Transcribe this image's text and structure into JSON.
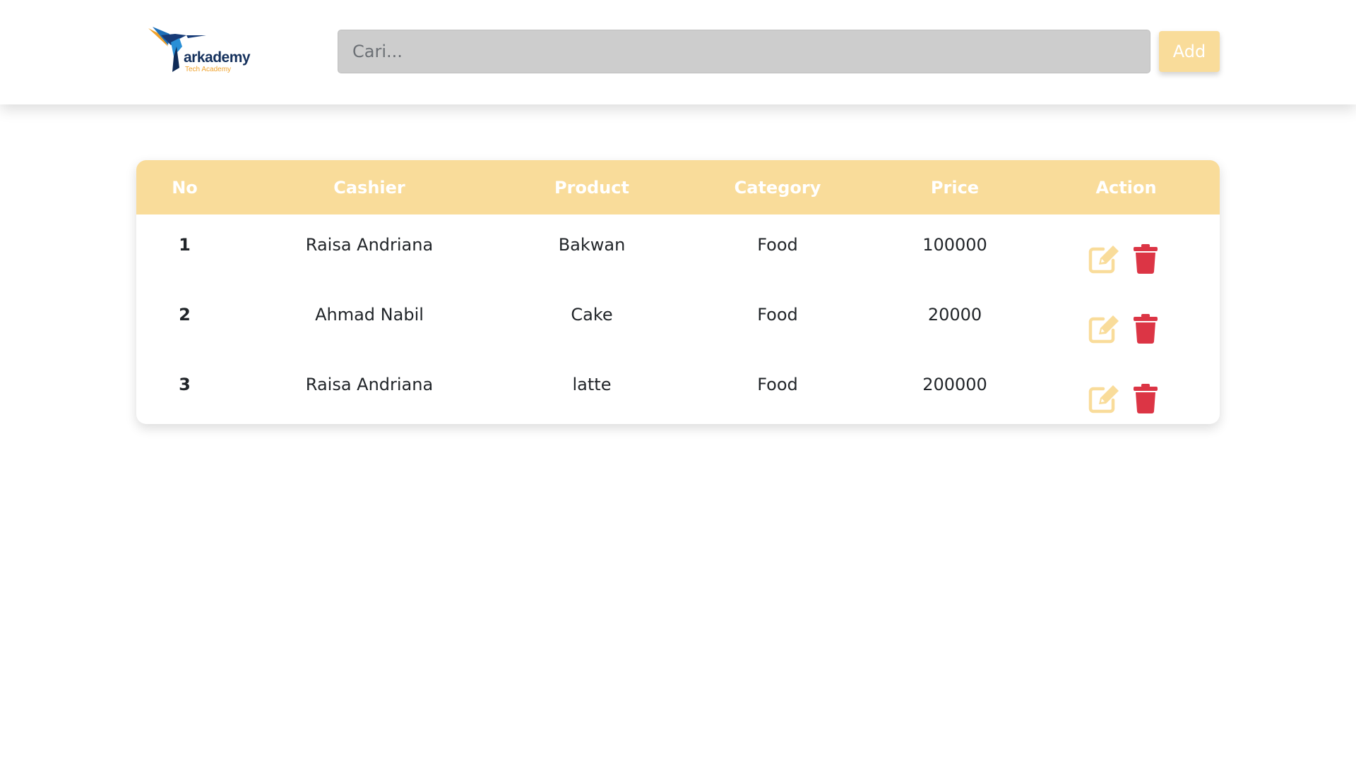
{
  "header": {
    "logo": {
      "name": "arkademy",
      "tagline": "Tech Academy"
    },
    "search": {
      "placeholder": "Cari...",
      "value": ""
    },
    "add_label": "Add"
  },
  "table": {
    "columns": [
      "No",
      "Cashier",
      "Product",
      "Category",
      "Price",
      "Action"
    ],
    "rows": [
      {
        "no": "1",
        "cashier": "Raisa Andriana",
        "product": "Bakwan",
        "category": "Food",
        "price": "100000"
      },
      {
        "no": "2",
        "cashier": "Ahmad Nabil",
        "product": "Cake",
        "category": "Food",
        "price": "20000"
      },
      {
        "no": "3",
        "cashier": "Raisa Andriana",
        "product": "latte",
        "category": "Food",
        "price": "200000"
      }
    ],
    "action_icons": [
      "edit-icon",
      "trash-icon"
    ]
  },
  "colors": {
    "accent": "#f9dc9a",
    "delete": "#dc3545",
    "edit": "#f9dc9a"
  }
}
